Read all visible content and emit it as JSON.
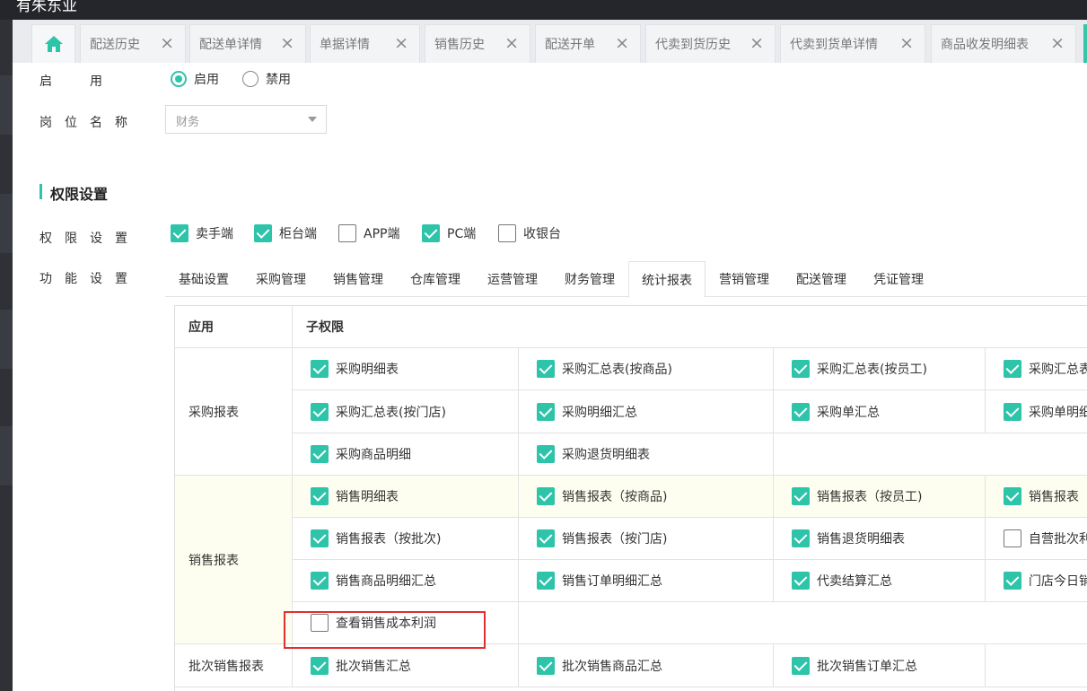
{
  "window": {
    "title": "有朱东业"
  },
  "tabs": [
    {
      "label": "配送历史"
    },
    {
      "label": "配送单详情"
    },
    {
      "label": "单据详情"
    },
    {
      "label": "销售历史"
    },
    {
      "label": "配送开单"
    },
    {
      "label": "代卖到货历史"
    },
    {
      "label": "代卖到货单详情"
    },
    {
      "label": "商品收发明细表"
    }
  ],
  "form": {
    "enable_label": "启　　　用",
    "enable_options": [
      "启用",
      "禁用"
    ],
    "enable_selected": "启用",
    "position_label": "岗　位　名　称",
    "position_value": "财务",
    "section_title": "权限设置",
    "perm_label": "权　限　设　置",
    "func_label": "功　能　设　置",
    "perm_options": [
      {
        "label": "卖手端",
        "checked": true
      },
      {
        "label": "柜台端",
        "checked": true
      },
      {
        "label": "APP端",
        "checked": false
      },
      {
        "label": "PC端",
        "checked": true
      },
      {
        "label": "收银台",
        "checked": false
      }
    ]
  },
  "func_tabs": [
    "基础设置",
    "采购管理",
    "销售管理",
    "仓库管理",
    "运营管理",
    "财务管理",
    "统计报表",
    "营销管理",
    "配送管理",
    "凭证管理"
  ],
  "active_func_tab": "统计报表",
  "table": {
    "headers": [
      "应用",
      "子权限"
    ],
    "groups": [
      {
        "name": "采购报表",
        "rows": [
          [
            {
              "label": "采购明细表",
              "checked": true
            },
            {
              "label": "采购汇总表(按商品)",
              "checked": true
            },
            {
              "label": "采购汇总表(按员工)",
              "checked": true
            },
            {
              "label": "采购汇总表",
              "checked": true
            }
          ],
          [
            {
              "label": "采购汇总表(按门店)",
              "checked": true
            },
            {
              "label": "采购明细汇总",
              "checked": true
            },
            {
              "label": "采购单汇总",
              "checked": true
            },
            {
              "label": "采购单明细",
              "checked": true
            }
          ],
          [
            {
              "label": "采购商品明细",
              "checked": true
            },
            {
              "label": "采购退货明细表",
              "checked": true
            }
          ]
        ]
      },
      {
        "name": "销售报表",
        "rows": [
          [
            {
              "label": "销售明细表",
              "checked": true
            },
            {
              "label": "销售报表（按商品)",
              "checked": true
            },
            {
              "label": "销售报表（按员工)",
              "checked": true
            },
            {
              "label": "销售报表（",
              "checked": true
            }
          ],
          [
            {
              "label": "销售报表（按批次)",
              "checked": true
            },
            {
              "label": "销售报表（按门店)",
              "checked": true
            },
            {
              "label": "销售退货明细表",
              "checked": true
            },
            {
              "label": "自营批次利",
              "checked": false
            }
          ],
          [
            {
              "label": "销售商品明细汇总",
              "checked": true
            },
            {
              "label": "销售订单明细汇总",
              "checked": true
            },
            {
              "label": "代卖结算汇总",
              "checked": true
            },
            {
              "label": "门店今日销",
              "checked": true
            }
          ],
          [
            {
              "label": "查看销售成本利润",
              "checked": false
            }
          ]
        ]
      },
      {
        "name": "批次销售报表",
        "rows": [
          [
            {
              "label": "批次销售汇总",
              "checked": true
            },
            {
              "label": "批次销售商品汇总",
              "checked": true
            },
            {
              "label": "批次销售订单汇总",
              "checked": true
            }
          ]
        ]
      }
    ]
  },
  "colors": {
    "accent": "#2ec4a9",
    "highlight": "#e0302e",
    "sidebar": "#2b2d33"
  }
}
